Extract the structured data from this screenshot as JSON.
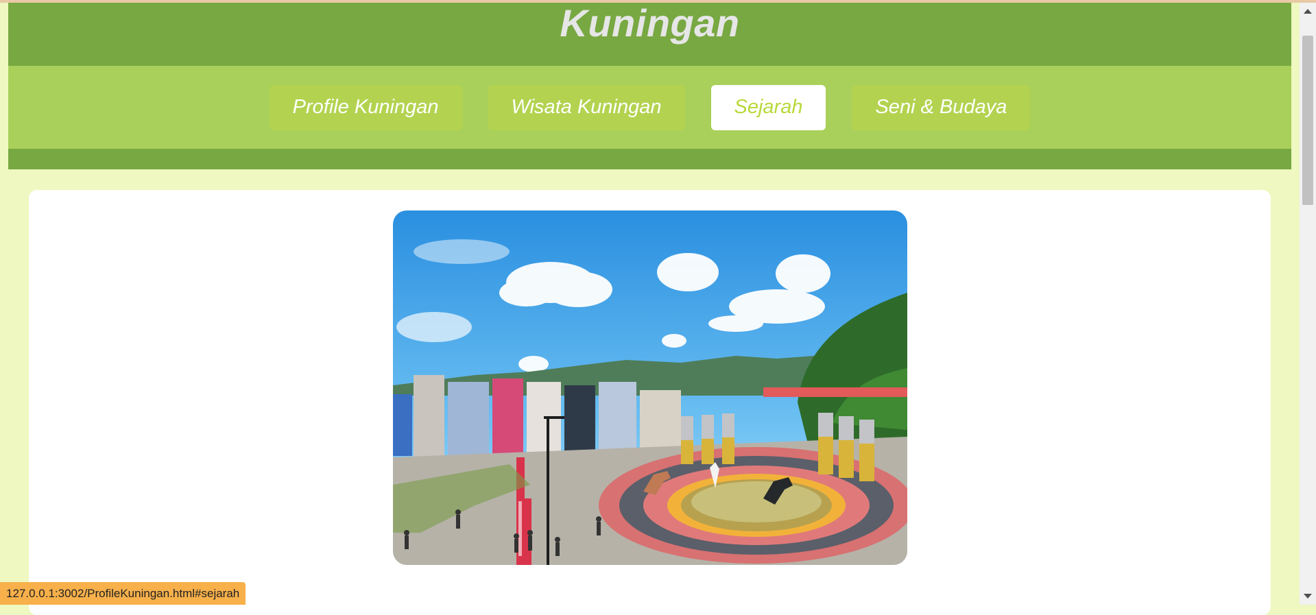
{
  "header": {
    "title": "Kuningan"
  },
  "nav": {
    "items": [
      {
        "label": "Profile Kuningan",
        "active": false
      },
      {
        "label": "Wisata Kuningan",
        "active": false
      },
      {
        "label": "Sejarah",
        "active": true
      },
      {
        "label": "Seni & Budaya",
        "active": false
      }
    ]
  },
  "content": {
    "image": "Kuningan city square photo"
  },
  "status": {
    "url": "127.0.0.1:3002/ProfileKuningan.html#sejarah"
  },
  "colors": {
    "header": "#78a842",
    "nav_band": "#a9d05a",
    "nav_button": "#b3d350",
    "page_background": "#eef8c0",
    "status_bar": "#f7b04a"
  }
}
